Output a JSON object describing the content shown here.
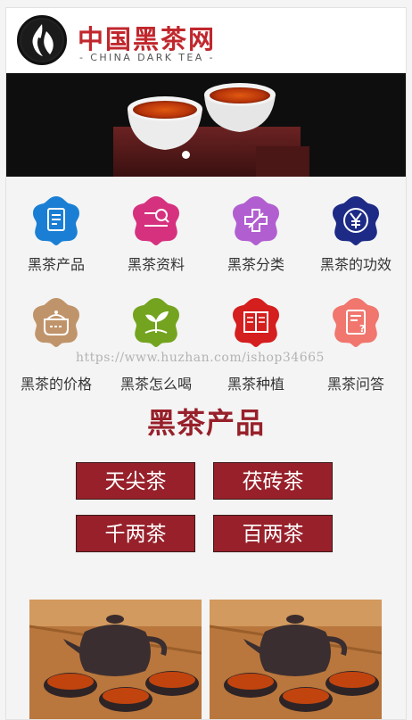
{
  "header": {
    "title": "中国黑茶网",
    "subtitle": "- CHINA DARK TEA -",
    "logo_icon": "flame-logo-icon"
  },
  "banner": {
    "slide_count": 1,
    "active_slide": 1
  },
  "categories": [
    {
      "label": "黑茶产品",
      "icon": "document-icon",
      "color": "#1a7fd4"
    },
    {
      "label": "黑茶资料",
      "icon": "search-list-icon",
      "color": "#d6317f"
    },
    {
      "label": "黑茶分类",
      "icon": "plus-leaf-icon",
      "color": "#b15fd0"
    },
    {
      "label": "黑茶的功效",
      "icon": "yen-icon",
      "color": "#1d2b86"
    },
    {
      "label": "黑茶的价格",
      "icon": "pot-icon",
      "color": "#c0946a"
    },
    {
      "label": "黑茶怎么喝",
      "icon": "sprout-icon",
      "color": "#74a41f"
    },
    {
      "label": "黑茶种植",
      "icon": "book-icon",
      "color": "#d51e1e"
    },
    {
      "label": "黑茶问答",
      "icon": "question-doc-icon",
      "color": "#f0766e"
    }
  ],
  "watermark": "https://www.huzhan.com/ishop34665",
  "products": {
    "title": "黑茶产品",
    "buttons": [
      "天尖茶",
      "茯砖茶",
      "千两茶",
      "百两茶"
    ]
  }
}
